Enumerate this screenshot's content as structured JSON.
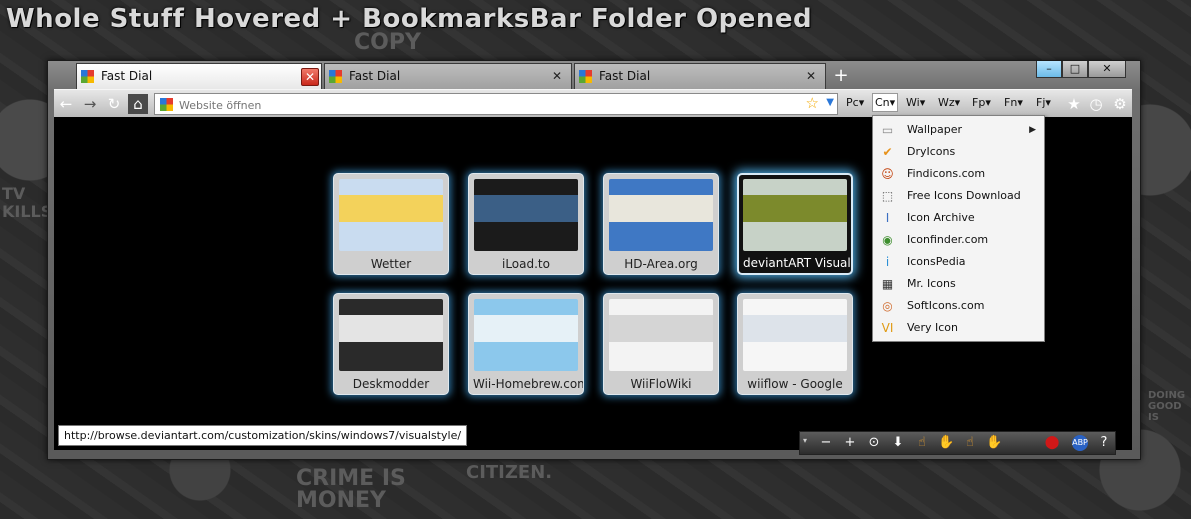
{
  "headline": "Whole Stuff Hovered + BookmarksBar Folder Opened",
  "background_text": [
    "COPY",
    "CRIME IS MONEY",
    "CITIZEN.",
    "TV KILLS",
    "DOING GOOD IS"
  ],
  "tabs": [
    {
      "label": "Fast Dial",
      "active": true,
      "close": "✕"
    },
    {
      "label": "Fast Dial",
      "active": false,
      "close": "✕"
    },
    {
      "label": "Fast Dial",
      "active": false,
      "close": "✕"
    }
  ],
  "new_tab_glyph": "+",
  "window_controls": {
    "minimize": "–",
    "maximize": "□",
    "close": "✕"
  },
  "nav": {
    "back": "←",
    "forward": "→",
    "reload": "↻",
    "home": "⌂"
  },
  "urlbar": {
    "placeholder": "Website öffnen",
    "star": "☆",
    "dropdown": "▼"
  },
  "bookmarks": [
    {
      "label": "Pc",
      "open": false
    },
    {
      "label": "Cn",
      "open": true
    },
    {
      "label": "Wi",
      "open": false
    },
    {
      "label": "Wz",
      "open": false
    },
    {
      "label": "Fp",
      "open": false
    },
    {
      "label": "Fn",
      "open": false
    },
    {
      "label": "Fj",
      "open": false
    }
  ],
  "bookmark_caret": "▾",
  "toolbar_right": {
    "bookmarks_icon": "★",
    "history_icon": "◷",
    "settings_icon": "⚙"
  },
  "tiles": [
    {
      "label": "Wetter",
      "hover": false,
      "colors": [
        "#c9dcf0",
        "#f3d25b"
      ]
    },
    {
      "label": "iLoad.to",
      "hover": false,
      "colors": [
        "#1b1b1b",
        "#3b5f86"
      ]
    },
    {
      "label": "HD-Area.org",
      "hover": false,
      "colors": [
        "#3f78c4",
        "#e8e6dc"
      ]
    },
    {
      "label": "deviantART Visual",
      "hover": true,
      "colors": [
        "#c7d2c7",
        "#7c8a2c"
      ]
    },
    {
      "label": "Deskmodder",
      "hover": false,
      "colors": [
        "#2a2a2a",
        "#e4e4e4"
      ]
    },
    {
      "label": "Wii-Homebrew.com",
      "hover": false,
      "colors": [
        "#8cc8ec",
        "#e6f1f7"
      ]
    },
    {
      "label": "WiiFloWiki",
      "hover": false,
      "colors": [
        "#f3f3f3",
        "#d5d5d5"
      ]
    },
    {
      "label": "wiiflow - Google",
      "hover": false,
      "colors": [
        "#f6f6f6",
        "#dde3ea"
      ]
    }
  ],
  "menu_items": [
    {
      "label": "Wallpaper",
      "icon": "page-icon",
      "glyph": "▭",
      "color": "#8a8a8a",
      "submenu": true
    },
    {
      "label": "DryIcons",
      "icon": "check-icon",
      "glyph": "✔",
      "color": "#e7921b",
      "submenu": false
    },
    {
      "label": "Findicons.com",
      "icon": "faces-icon",
      "glyph": "☺",
      "color": "#c2410c",
      "submenu": false
    },
    {
      "label": "Free Icons Download",
      "icon": "dotted-square-icon",
      "glyph": "⬚",
      "color": "#555555",
      "submenu": false
    },
    {
      "label": "Icon Archive",
      "icon": "info-icon",
      "glyph": "I",
      "color": "#3b6fc2",
      "submenu": false
    },
    {
      "label": "Iconfinder.com",
      "icon": "eye-icon",
      "glyph": "◉",
      "color": "#3e8e2e",
      "submenu": false
    },
    {
      "label": "IconsPedia",
      "icon": "pedia-icon",
      "glyph": "i",
      "color": "#2a8fd6",
      "submenu": false
    },
    {
      "label": "Mr. Icons",
      "icon": "mr-icons-icon",
      "glyph": "▦",
      "color": "#333333",
      "submenu": false
    },
    {
      "label": "SoftIcons.com",
      "icon": "disc-icon",
      "glyph": "◎",
      "color": "#d06a2b",
      "submenu": false
    },
    {
      "label": "Very Icon",
      "icon": "vi-icon",
      "glyph": "VI",
      "color": "#e09a12",
      "submenu": false
    }
  ],
  "submenu_arrow": "▶",
  "status_url": "http://browse.deviantart.com/customization/skins/windows7/visualstyle/",
  "zoombar": {
    "caret": "▾",
    "buttons": [
      {
        "name": "zoom-out-button",
        "glyph": "−"
      },
      {
        "name": "zoom-in-button",
        "glyph": "+"
      },
      {
        "name": "zoom-reset-button",
        "glyph": "⊙"
      },
      {
        "name": "download-button",
        "glyph": "⬇"
      },
      {
        "name": "addon-hand-button",
        "glyph": "☝"
      },
      {
        "name": "addon-fox-button",
        "glyph": "✋"
      },
      {
        "name": "addon-blue-button",
        "glyph": "☝"
      },
      {
        "name": "addon-orange-button",
        "glyph": "✋"
      },
      {
        "name": "adblock-stop-button",
        "glyph": "⬤"
      },
      {
        "name": "abp-button",
        "glyph": "ABP"
      },
      {
        "name": "help-button",
        "glyph": "?"
      }
    ]
  }
}
